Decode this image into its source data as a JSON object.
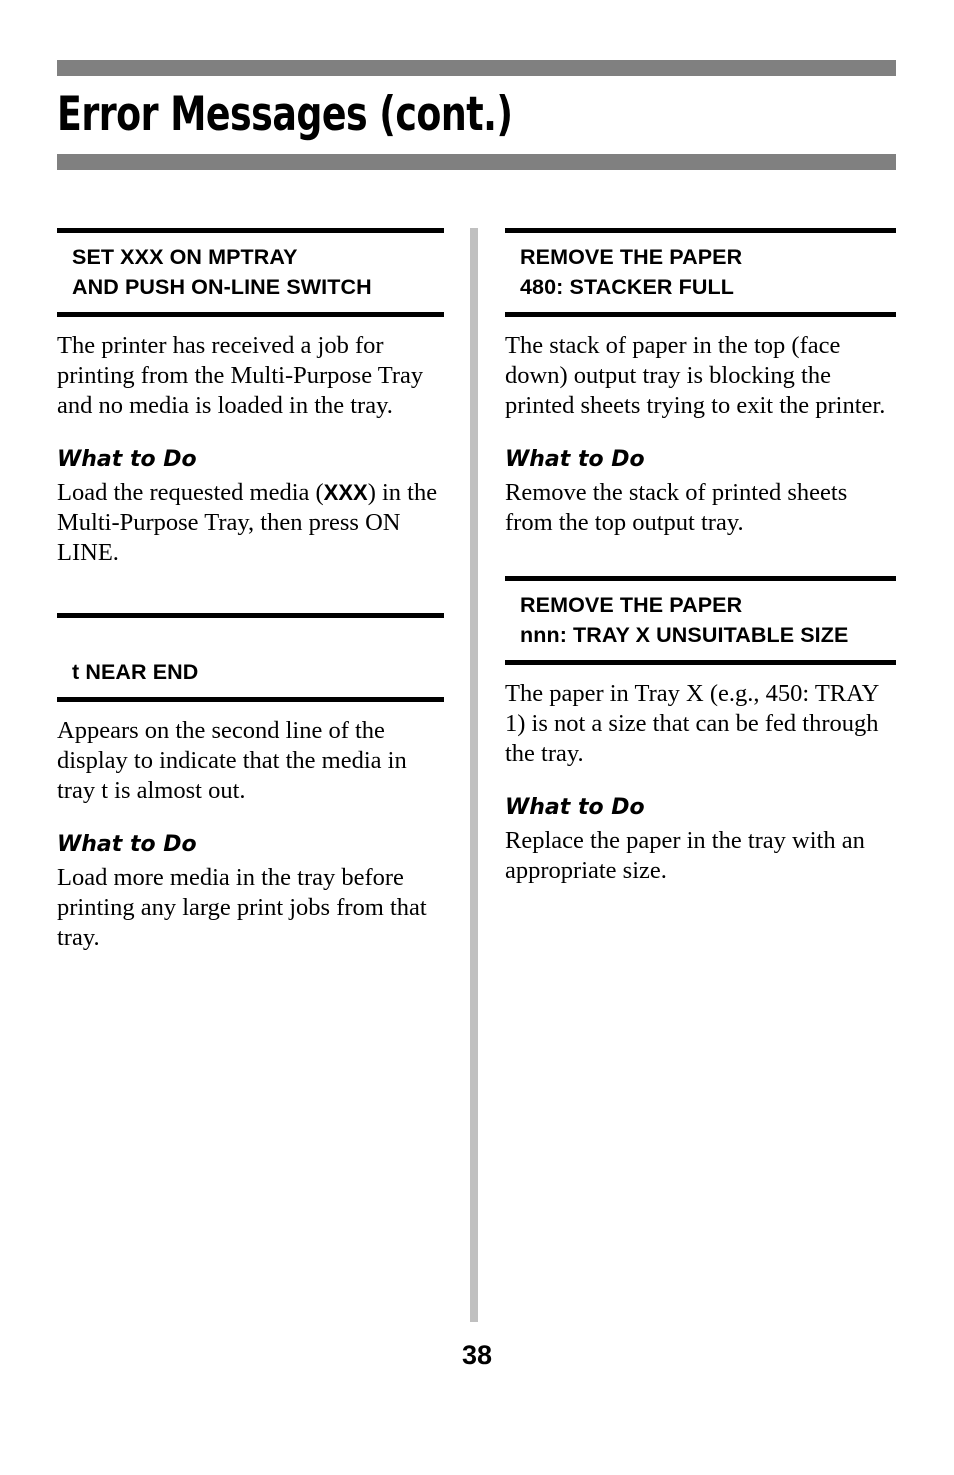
{
  "document": {
    "title": "Error Messages (cont.)",
    "page_number": "38",
    "accent_bar_color": "#808080",
    "rule_color": "#000000",
    "divider_color": "#c0c0c0"
  },
  "columns": {
    "left": [
      {
        "heading_lines": [
          "SET XXX ON MPTRAY",
          "AND PUSH ON-LINE SWITCH"
        ],
        "description": "The printer has received a job for printing from the Multi-Purpose Tray and no media is loaded in the tray.",
        "what_to_do_label": "What to Do",
        "action_pre": "Load the requested media (",
        "action_code": "XXX",
        "action_post": ") in the Multi-Purpose Tray, then press ON LINE."
      },
      {
        "heading_lines": [
          "t NEAR END"
        ],
        "description": "Appears on the second line of the display to indicate that the media in tray t is almost out.",
        "what_to_do_label": "What to Do",
        "action": "Load more media in the tray before printing any large print jobs from that tray."
      }
    ],
    "right": [
      {
        "heading_lines": [
          "REMOVE THE PAPER",
          "480: STACKER FULL"
        ],
        "description": "The stack of paper in the top (face down) output tray is blocking the printed sheets trying to exit the printer.",
        "what_to_do_label": "What to Do",
        "action": "Remove the stack of printed sheets from the top output tray."
      },
      {
        "heading_lines": [
          "REMOVE THE PAPER",
          "nnn: TRAY X UNSUITABLE SIZE"
        ],
        "description": "The paper in Tray X (e.g., 450: TRAY 1) is not a size that can be fed through the tray.",
        "what_to_do_label": "What to Do",
        "action": "Replace the paper in the tray with an appropriate size."
      }
    ]
  }
}
